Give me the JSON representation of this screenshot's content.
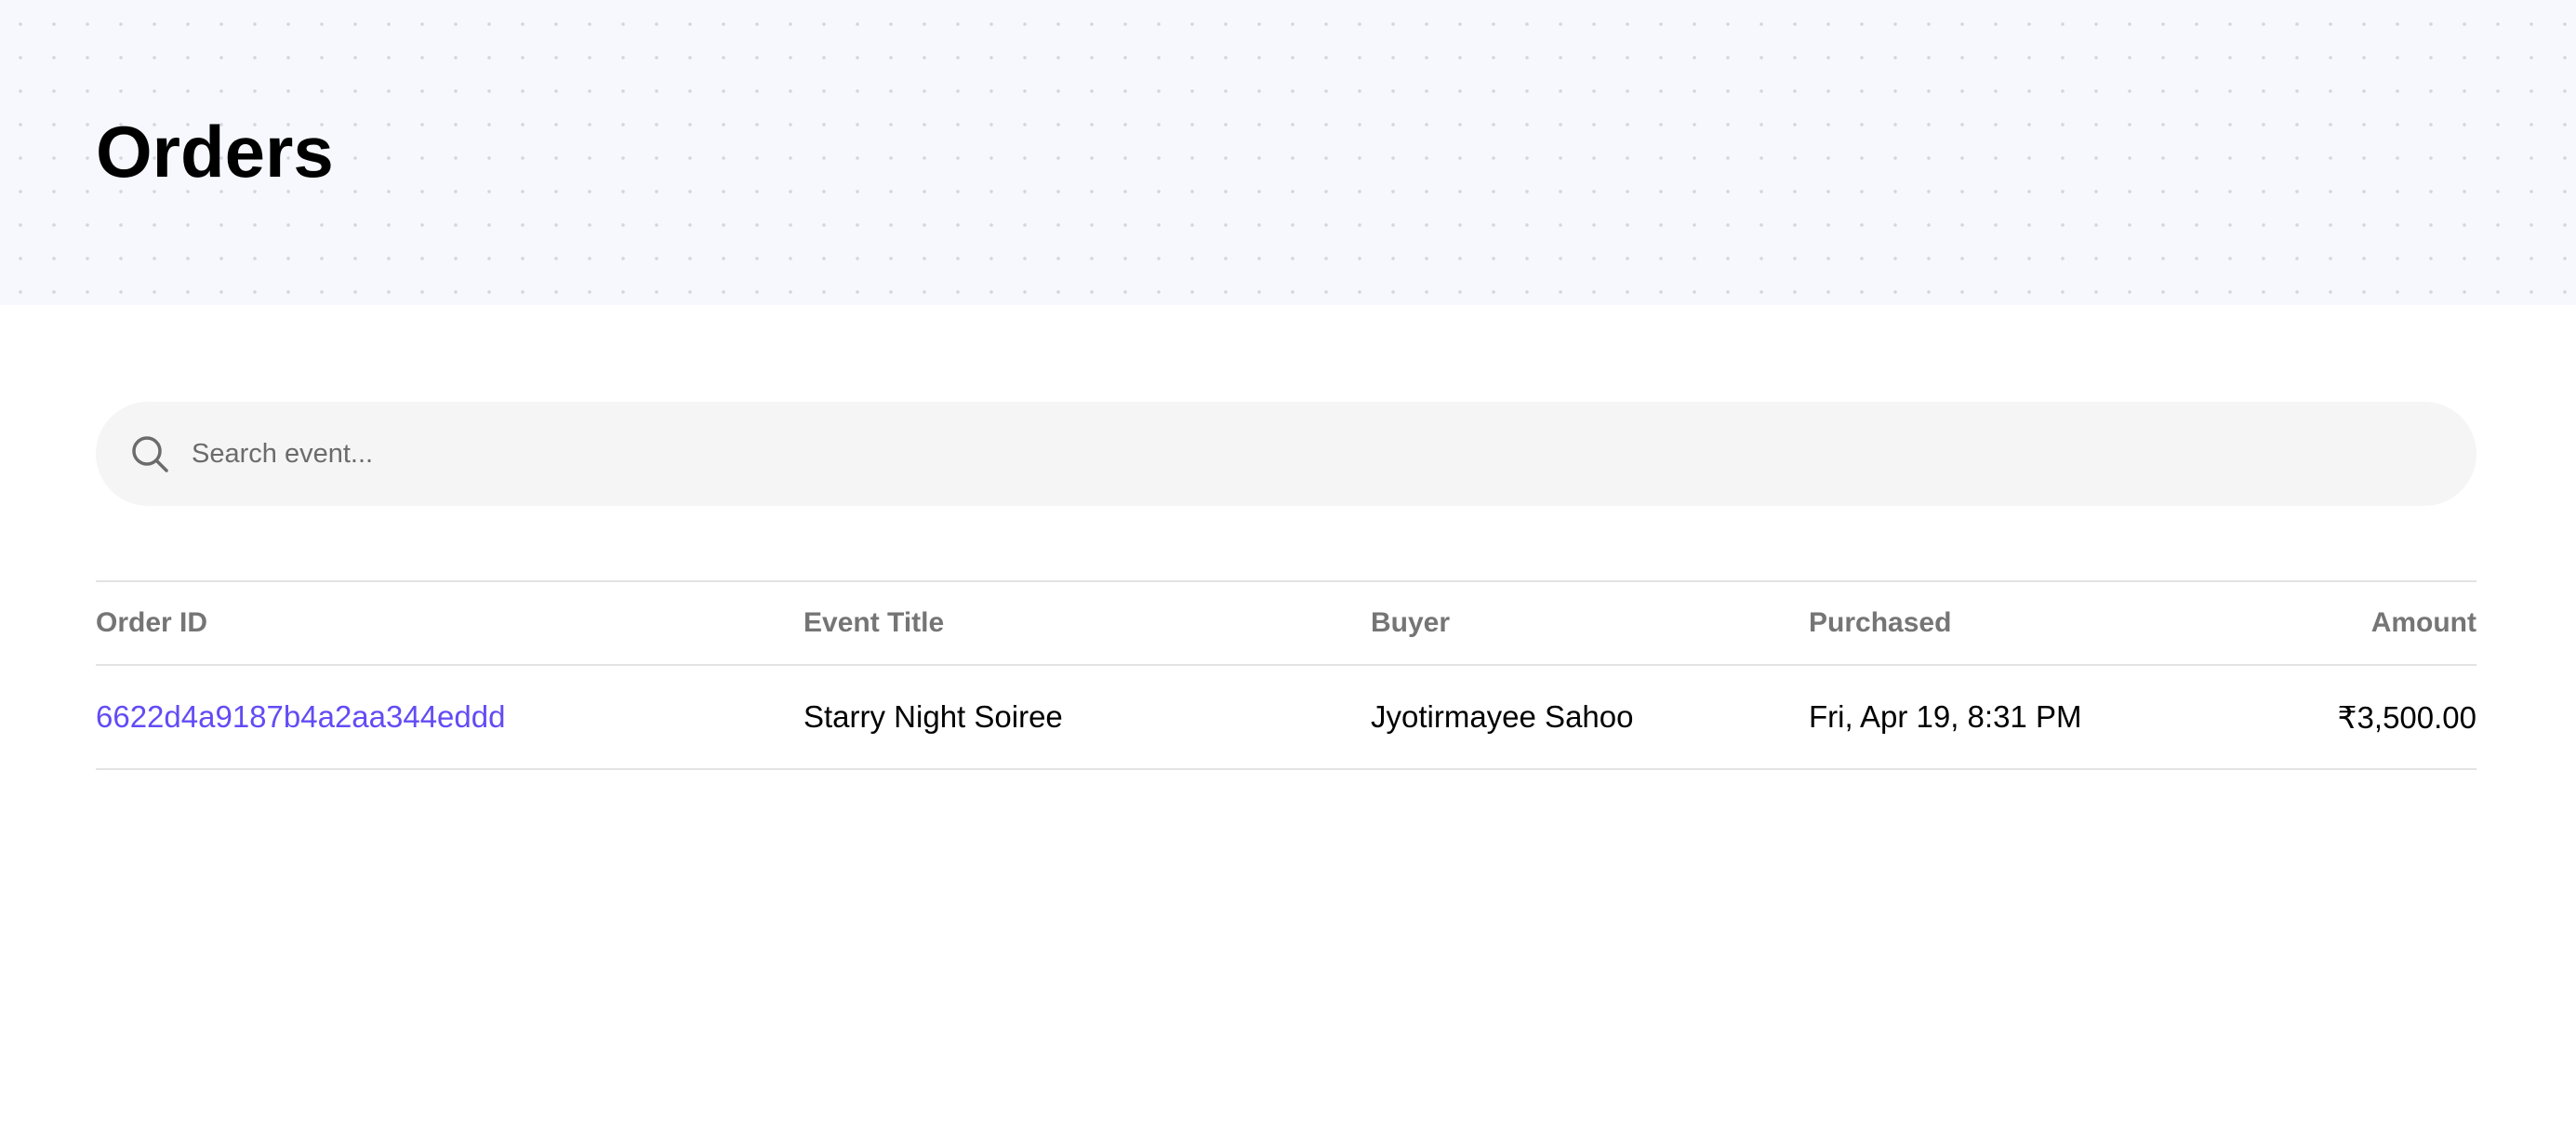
{
  "header": {
    "title": "Orders"
  },
  "search": {
    "placeholder": "Search event...",
    "value": "",
    "icon": "search-icon"
  },
  "table": {
    "columns": [
      "Order ID",
      "Event Title",
      "Buyer",
      "Purchased",
      "Amount"
    ],
    "rows": [
      {
        "order_id": "6622d4a9187b4a2aa344eddd",
        "event_title": "Starry Night Soiree",
        "buyer": "Jyotirmayee Sahoo",
        "purchased": "Fri, Apr 19, 8:31 PM",
        "amount": "₹3,500.00"
      }
    ]
  },
  "colors": {
    "accent": "#624cf5",
    "hero_bg": "#f6f8fd",
    "search_bg": "#f5f5f5",
    "header_text": "#757575"
  }
}
